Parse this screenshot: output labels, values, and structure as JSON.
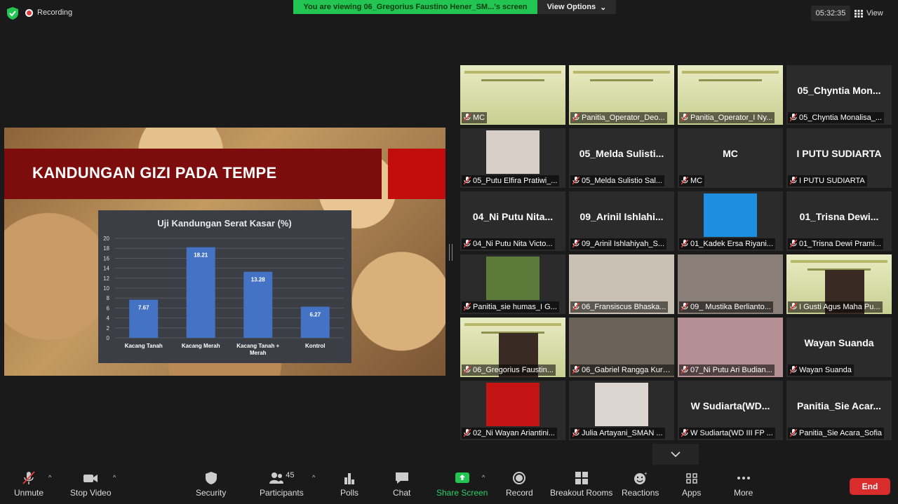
{
  "topbar": {
    "recording_label": "Recording",
    "viewing_banner": "You are viewing 06_Gregorius Faustino Hener_SM...'s screen",
    "view_options_label": "View Options",
    "clock": "05:32:35",
    "view_label": "View"
  },
  "slide": {
    "title": "KANDUNGAN GIZI PADA TEMPE"
  },
  "chart_data": {
    "type": "bar",
    "title": "Uji  Kandungan  Serat Kasar  (%)",
    "categories": [
      "Kacang Tanah",
      "Kacang Merah",
      "Kacang Tanah + Merah",
      "Kontrol"
    ],
    "values": [
      7.67,
      18.21,
      13.28,
      6.27
    ],
    "value_labels": [
      "7.67",
      "18.21",
      "13.28",
      "6.27"
    ],
    "ylim": [
      0,
      20
    ],
    "yticks": [
      "0",
      "2",
      "4",
      "6",
      "8",
      "10",
      "12",
      "14",
      "16",
      "18",
      "20"
    ],
    "grid": true,
    "bar_color": "#4472c4"
  },
  "gallery": [
    {
      "big": "",
      "label": "MC",
      "poster": true
    },
    {
      "big": "",
      "label": "Panitia_Operator_Deo...",
      "poster": true
    },
    {
      "big": "",
      "label": "Panitia_Operator_I Ny...",
      "poster": true
    },
    {
      "big": "05_Chyntia  Mon...",
      "label": "05_Chyntia Monalisa_..."
    },
    {
      "big": "",
      "label": "05_Putu Elfira Pratiwi_...",
      "photo": "group"
    },
    {
      "big": "05_Melda  Sulisti...",
      "label": "05_Melda Sulistio Sal..."
    },
    {
      "big": "MC",
      "label": "MC"
    },
    {
      "big": "I PUTU SUDIARTA",
      "label": "I PUTU SUDIARTA"
    },
    {
      "big": "04_Ni  Putu  Nita...",
      "label": "04_Ni Putu Nita Victo..."
    },
    {
      "big": "09_Arinil  Ishlahi...",
      "label": "09_Arinil Ishlahiyah_S..."
    },
    {
      "big": "",
      "label": "01_Kadek Ersa Riyani...",
      "photo": "blue"
    },
    {
      "big": "01_Trisna  Dewi...",
      "label": "01_Trisna Dewi Prami..."
    },
    {
      "big": "",
      "label": "Panitia_sie humas_I G...",
      "photo": "field"
    },
    {
      "big": "",
      "label": "06_Fransiscus Bhaska...",
      "photo": "room"
    },
    {
      "big": "",
      "label": "09_ Mustika Berlianto...",
      "photo": "hijab"
    },
    {
      "big": "",
      "label": "I Gusti Agus Maha Pu...",
      "poster": true,
      "photo": "man"
    },
    {
      "big": "",
      "label": "06_Gregorius Faustin...",
      "poster": true,
      "photo": "man"
    },
    {
      "big": "",
      "label": "06_Gabriel Rangga Kurni...",
      "photo": "cam",
      "active": true
    },
    {
      "big": "",
      "label": "07_Ni Putu Ari Budian...",
      "photo": "pink"
    },
    {
      "big": "Wayan Suanda",
      "label": "Wayan Suanda"
    },
    {
      "big": "",
      "label": "02_Ni Wayan Ariantini...",
      "photo": "red"
    },
    {
      "big": "",
      "label": "Julia Artayani_SMAN ...",
      "photo": "lady"
    },
    {
      "big": "W  Sudiarta(WD...",
      "label": "W Sudiarta(WD III FP ..."
    },
    {
      "big": "Panitia_Sie  Acar...",
      "label": "Panitia_Sie Acara_Sofia"
    }
  ],
  "toolbar": {
    "unmute": "Unmute",
    "stop_video": "Stop Video",
    "security": "Security",
    "participants": "Participants",
    "participants_count": "45",
    "polls": "Polls",
    "chat": "Chat",
    "share_screen": "Share Screen",
    "record": "Record",
    "breakout_rooms": "Breakout Rooms",
    "reactions": "Reactions",
    "apps": "Apps",
    "more": "More",
    "end": "End"
  }
}
